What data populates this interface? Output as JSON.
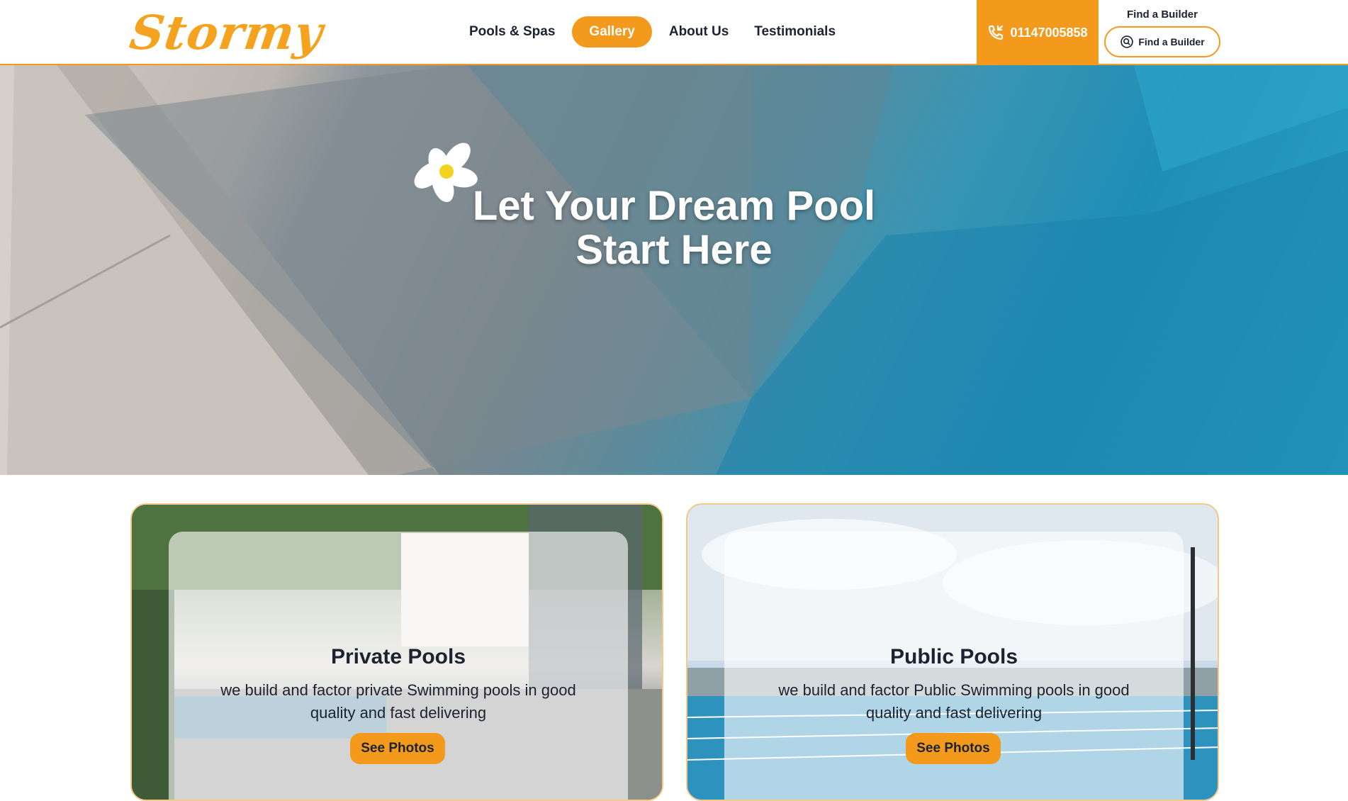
{
  "brand": {
    "logo": "Stormy",
    "accent": "#f39a1c"
  },
  "nav": {
    "items": [
      {
        "label": "Pools & Spas",
        "active": false
      },
      {
        "label": "Gallery",
        "active": true
      },
      {
        "label": "About Us",
        "active": false
      },
      {
        "label": "Testimonials",
        "active": false
      }
    ]
  },
  "header": {
    "phone": "01147005858",
    "phone_icon": "phone-icon",
    "builder_label": "Find a Builder",
    "builder_button": "Find a Builder",
    "builder_icon": "search-icon"
  },
  "hero": {
    "title_line1": "Let Your Dream Pool",
    "title_line2": "Start Here"
  },
  "cards": [
    {
      "title": "Private Pools",
      "text": "we build and factor private Swimming pools in good quality and fast delivering",
      "button": "See Photos"
    },
    {
      "title": "Public Pools",
      "text": "we build and factor Public Swimming pools in good quality and fast delivering",
      "button": "See Photos"
    }
  ]
}
